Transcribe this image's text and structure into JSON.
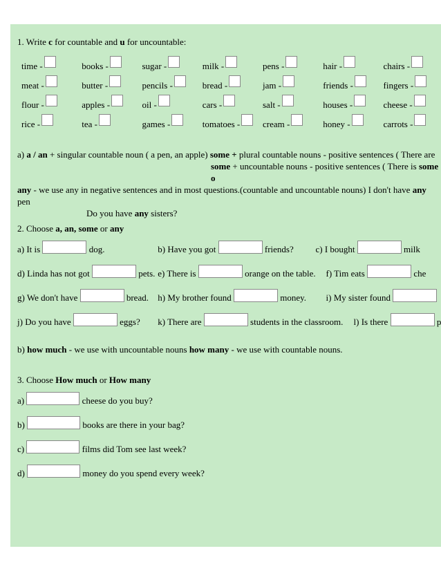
{
  "q1": {
    "title_pre": "1. Write ",
    "title_c": "c",
    "title_mid": " for countable and ",
    "title_u": "u",
    "title_post": " for uncountable:",
    "grid": [
      [
        "time -",
        "books -",
        "sugar -",
        "milk -",
        "pens -",
        "hair -",
        "chairs -"
      ],
      [
        "meat -",
        "butter -",
        "pencils -",
        "bread -",
        "jam -",
        "friends -",
        "fingers -"
      ],
      [
        "flour -",
        "apples -",
        "oil -",
        "cars -",
        "salt -",
        "houses -",
        "cheese -"
      ],
      [
        "rice -",
        "tea -",
        "games -",
        "tomatoes -",
        "cream -",
        "honey -",
        "carrots -"
      ]
    ],
    "hint_a_pre": " a)  ",
    "hint_a_bold": "a / an",
    "hint_a_mid": " + singular countable noun ( a pen, an apple)     ",
    "hint_some_bold": "some ",
    "hint_some_plus": " + ",
    "hint_some_rest": "plural countable nouns - positive sentences ( There are",
    "hint_some2_pre": "some",
    "hint_some2_rest": " +  uncountable nouns - positive sentences  ( There is ",
    "hint_some2_end": "some o",
    "hint_any_pre": "   ",
    "hint_any_bold": "any",
    "hint_any_rest": " - we use any in negative sentences and in most questions.(countable and uncountable nouns)  I don't have ",
    "hint_any_bold2": "any",
    "hint_any_end": " pen",
    "hint_any_q": "Do you have ",
    "hint_any_q_bold": "any",
    "hint_any_q_end": " sisters?"
  },
  "q2": {
    "title": "2. Choose ",
    "title_bold": "a, an, some",
    "title_mid": " or ",
    "title_bold2": "any",
    "a_pre": "a)  It is ",
    "a_post": " dog.",
    "b_pre": "b) Have you got ",
    "b_post": " friends?",
    "c_pre": "c)  I bought ",
    "c_post": " milk",
    "d_pre": "d) Linda has not got ",
    "d_post": " pets.",
    "e_pre": "e) There is ",
    "e_post": " orange on the table.",
    "f_pre": "f) Tim eats ",
    "f_post": " che",
    "g_pre": "g) We don't have ",
    "g_post": " bread.",
    "h_pre": "h) My brother found ",
    "h_post": " money.",
    "i_pre": "i) My sister found ",
    "j_pre": "j) Do you have ",
    "j_post": " eggs?",
    "k_pre": "k) There are ",
    "k_post": " students in the classroom.",
    "l_pre": "l) Is there ",
    "l_post": " penci"
  },
  "hint_b": {
    "pre": " b) ",
    "much_bold": "how much",
    "much_rest": " - we use with uncountable nouns          ",
    "many_bold": "how many",
    "many_rest": " - we use with countable nouns."
  },
  "q3": {
    "title_pre": "3. Choose ",
    "title_much": "How  much",
    "title_or": " or ",
    "title_many": "How many",
    "a": "a) ",
    "a_post": " cheese do you buy?",
    "b": "b) ",
    "b_post": " books are there in your bag?",
    "c": "c) ",
    "c_post": " films did Tom see last week?",
    "d": "d) ",
    "d_post": " money do you spend every week?"
  }
}
